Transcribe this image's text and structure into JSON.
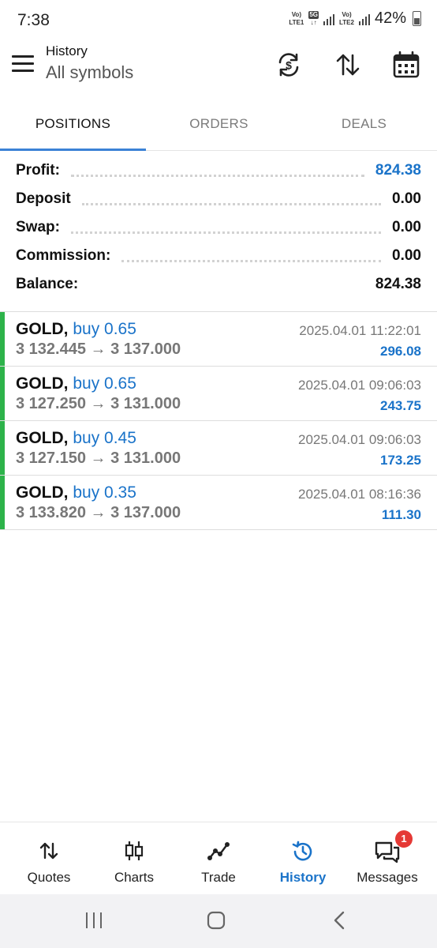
{
  "status_bar": {
    "time": "7:38",
    "sim1": "LTE1",
    "sim2": "LTE2",
    "network": "5G",
    "battery": "42%"
  },
  "header": {
    "title": "History",
    "subtitle": "All symbols",
    "icons": [
      "currency-refresh-icon",
      "sort-icon",
      "calendar-icon"
    ]
  },
  "tabs": [
    {
      "label": "POSITIONS",
      "active": true
    },
    {
      "label": "ORDERS",
      "active": false
    },
    {
      "label": "DEALS",
      "active": false
    }
  ],
  "summary": {
    "profit_label": "Profit:",
    "profit_value": "824.38",
    "deposit_label": "Deposit",
    "deposit_value": "0.00",
    "swap_label": "Swap:",
    "swap_value": "0.00",
    "commission_label": "Commission:",
    "commission_value": "0.00",
    "balance_label": "Balance:",
    "balance_value": "824.38"
  },
  "positions": [
    {
      "symbol": "GOLD,",
      "direction": "buy 0.65",
      "prices": "3 132.445 → 3 137.000",
      "time": "2025.04.01 11:22:01",
      "profit": "296.08"
    },
    {
      "symbol": "GOLD,",
      "direction": "buy 0.65",
      "prices": "3 127.250 → 3 131.000",
      "time": "2025.04.01 09:06:03",
      "profit": "243.75"
    },
    {
      "symbol": "GOLD,",
      "direction": "buy 0.45",
      "prices": "3 127.150 → 3 131.000",
      "time": "2025.04.01 09:06:03",
      "profit": "173.25"
    },
    {
      "symbol": "GOLD,",
      "direction": "buy 0.35",
      "prices": "3 133.820 → 3 137.000",
      "time": "2025.04.01 08:16:36",
      "profit": "111.30"
    }
  ],
  "bottom_nav": [
    {
      "label": "Quotes",
      "icon": "quotes-icon",
      "active": false
    },
    {
      "label": "Charts",
      "icon": "charts-icon",
      "active": false
    },
    {
      "label": "Trade",
      "icon": "trade-icon",
      "active": false
    },
    {
      "label": "History",
      "icon": "history-icon",
      "active": true
    },
    {
      "label": "Messages",
      "icon": "messages-icon",
      "active": false,
      "badge": "1"
    }
  ],
  "colors": {
    "accent": "#1a73c9",
    "buy_bar": "#2db34a",
    "badge": "#e53935",
    "tab_indicator": "#3b82d6"
  }
}
